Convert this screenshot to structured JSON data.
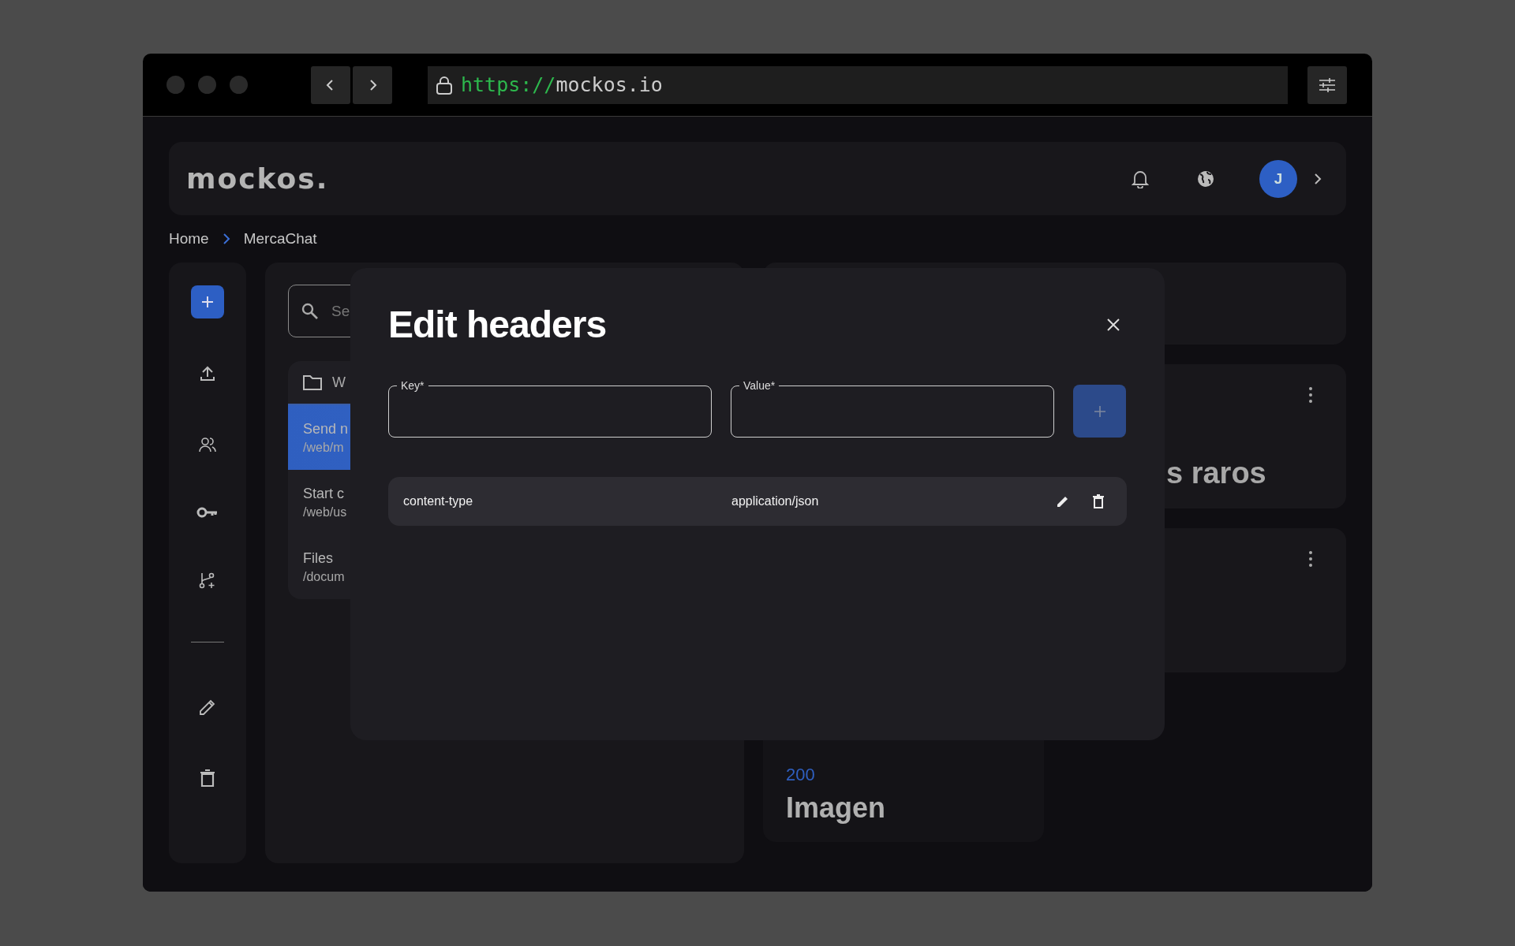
{
  "browser": {
    "url_scheme": "https://",
    "url_host": "mockos.io"
  },
  "header": {
    "logo": "mockos.",
    "avatar_initial": "J"
  },
  "breadcrumb": [
    "Home",
    "MercaChat"
  ],
  "search": {
    "placeholder": "Se"
  },
  "folder": {
    "name": "W"
  },
  "endpoints": [
    {
      "name": "Send n",
      "path": "/web/m",
      "selected": true
    },
    {
      "name": "Start c",
      "path": "/web/us",
      "selected": false
    },
    {
      "name": "Files",
      "path": "/docum",
      "selected": false
    }
  ],
  "mock_card": {
    "title": "s raros"
  },
  "response_card": {
    "status": "200",
    "name": "Imagen"
  },
  "modal": {
    "title": "Edit headers",
    "fields": [
      {
        "label": "Key*"
      },
      {
        "label": "Value*"
      }
    ],
    "headers": [
      {
        "key": "content-type",
        "value": "application/json"
      }
    ]
  }
}
